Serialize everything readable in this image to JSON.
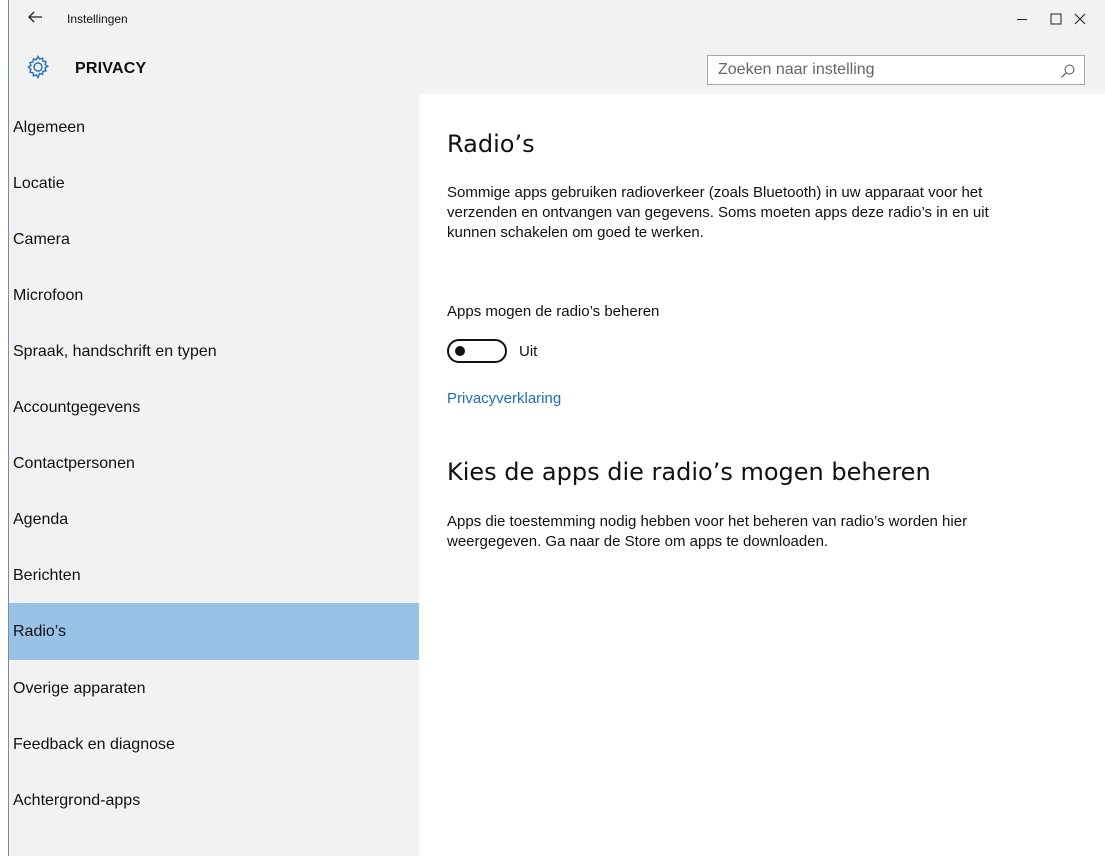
{
  "window": {
    "title": "Instellingen",
    "controls": {
      "minimize": "minimize",
      "maximize": "maximize",
      "close": "close"
    }
  },
  "header": {
    "icon": "gear-icon",
    "title": "PRIVACY",
    "search": {
      "placeholder": "Zoeken naar instelling",
      "value": ""
    }
  },
  "sidebar": {
    "selected_index": 9,
    "items": [
      {
        "label": "Algemeen"
      },
      {
        "label": "Locatie"
      },
      {
        "label": "Camera"
      },
      {
        "label": "Microfoon"
      },
      {
        "label": "Spraak, handschrift en typen"
      },
      {
        "label": "Accountgegevens"
      },
      {
        "label": "Contactpersonen"
      },
      {
        "label": "Agenda"
      },
      {
        "label": "Berichten"
      },
      {
        "label": "Radio’s"
      },
      {
        "label": "Overige apparaten"
      },
      {
        "label": "Feedback en diagnose"
      },
      {
        "label": "Achtergrond-apps"
      }
    ]
  },
  "main": {
    "heading": "Radio’s",
    "description": "Sommige apps gebruiken radioverkeer (zoals Bluetooth) in uw apparaat voor het verzenden en ontvangen van gegevens. Soms moeten apps deze radio’s in en uit kunnen schakelen om goed te werken.",
    "toggle": {
      "label": "Apps mogen de radio’s beheren",
      "state": "Uit",
      "on": false
    },
    "privacy_link": "Privacyverklaring",
    "apps_heading": "Kies de apps die radio’s mogen beheren",
    "apps_description": "Apps die toestemming nodig hebben voor het beheren van radio’s worden hier weergegeven. Ga naar de Store om apps te downloaden."
  },
  "colors": {
    "selected_item": "#99c3e6",
    "link": "#1b6fbf",
    "sidebar_bg": "#f2f2f2"
  }
}
